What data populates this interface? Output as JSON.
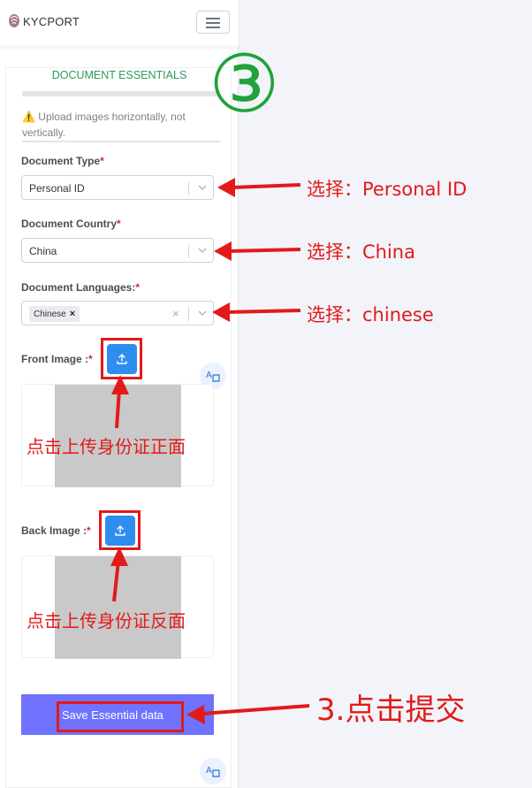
{
  "app": {
    "brand": "KYCPORT"
  },
  "card": {
    "title": "DOCUMENT ESSENTIALS",
    "notice": "⚠️ Upload images horizontally, not vertically."
  },
  "form": {
    "document_type": {
      "label": "Document Type",
      "value": "Personal ID"
    },
    "document_country": {
      "label": "Document Country",
      "value": "China"
    },
    "document_languages": {
      "label": "Document Languages:",
      "tags": [
        "Chinese"
      ],
      "clear": "×"
    },
    "front_image": {
      "label": "Front Image :"
    },
    "back_image": {
      "label": "Back Image :"
    },
    "required_mark": "*",
    "tag_remove": "×",
    "save_label": "Save Essential data"
  },
  "annotations": {
    "step_number": "③",
    "select_type": "选择：Personal ID",
    "select_country": "选择：China",
    "select_language": "选择：chinese",
    "upload_front": "点击上传身份证正面",
    "upload_back": "点击上传身份证反面",
    "submit": "3.点击提交"
  },
  "colors": {
    "accent_green": "#2c9a5c",
    "upload_blue": "#2e8ef0",
    "save_button": "#6f73ff",
    "annotation_red": "#e21a1a",
    "circle_green": "#1fa33a"
  }
}
